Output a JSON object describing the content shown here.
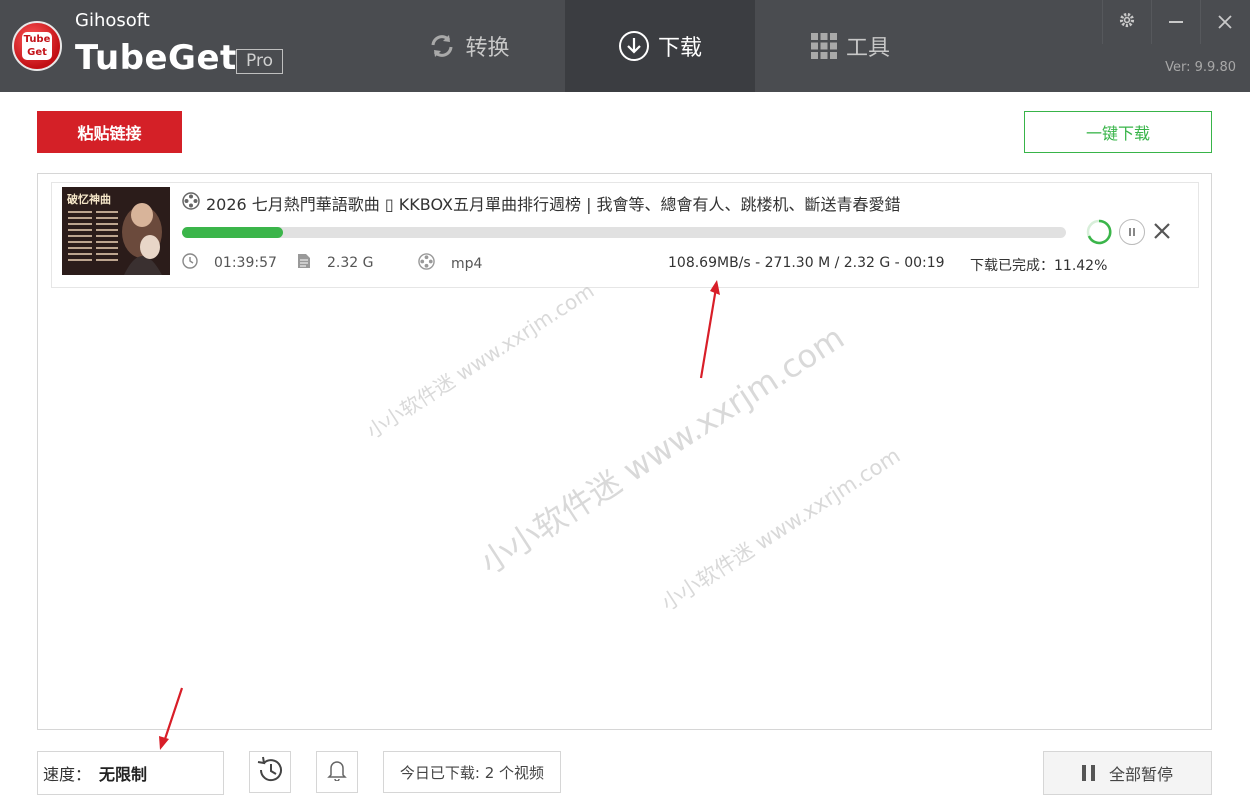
{
  "app": {
    "vendor": "Gihosoft",
    "name": "TubeGet",
    "edition": "Pro",
    "version": "Ver: 9.9.80",
    "logo_text_top": "Tube",
    "logo_text_bottom": "Get"
  },
  "tabs": [
    {
      "label": "转换",
      "icon": "refresh-icon",
      "active": false
    },
    {
      "label": "下载",
      "icon": "download-icon",
      "active": true
    },
    {
      "label": "工具",
      "icon": "grid-icon",
      "active": false
    }
  ],
  "window_controls": [
    "gear-icon",
    "minimize-icon",
    "close-icon"
  ],
  "toolbar": {
    "paste_label": "粘贴链接",
    "onekey_label": "一键下载"
  },
  "download_item": {
    "title": "2026 七月熱門華語歌曲 ▯ KKBOX五月單曲排行週榜 | 我會等、總會有人、跳楼机、斷送青春愛錯",
    "thumbnail_caption": "破忆神曲",
    "progress_percent": 11.42,
    "duration": "01:39:57",
    "size": "2.32 G",
    "format": "mp4",
    "speed_info": "108.69MB/s - 271.30 M / 2.32 G - 00:19",
    "done_label": "下载已完成：11.42%"
  },
  "watermark": {
    "text": "小小软件迷  www.xxrjm.com"
  },
  "bottom": {
    "speed_label": "速度：",
    "speed_value": "无限制",
    "today_label": "今日已下载: 2 个视频",
    "pause_all_label": "全部暂停"
  },
  "colors": {
    "titlebar": "#4a4c50",
    "accent_red": "#d42027",
    "accent_green": "#38b449",
    "progress_green": "#3bb54a",
    "annotation_red": "#d81e28"
  }
}
